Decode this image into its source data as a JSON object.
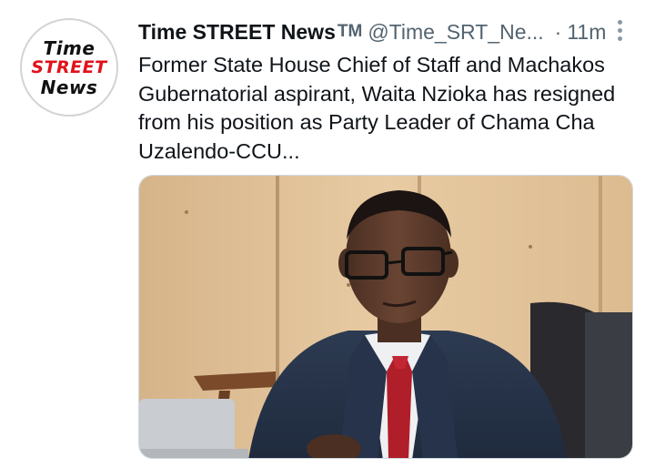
{
  "account": {
    "avatar_logo": {
      "line1": "Time",
      "line2": "STREET",
      "line3": "News"
    },
    "display_name": "Time STREET News",
    "trademark": "TM",
    "handle": "@Time_SRT_Ne...",
    "separator": "·",
    "timestamp": "11m"
  },
  "tweet": {
    "text": "Former State House Chief of Staff and Machakos Gubernatorial aspirant, Waita Nzioka has resigned from his position as Party Leader of Chama Cha Uzalendo-CCU..."
  },
  "icons": {
    "more": "more-vertical-icon"
  }
}
